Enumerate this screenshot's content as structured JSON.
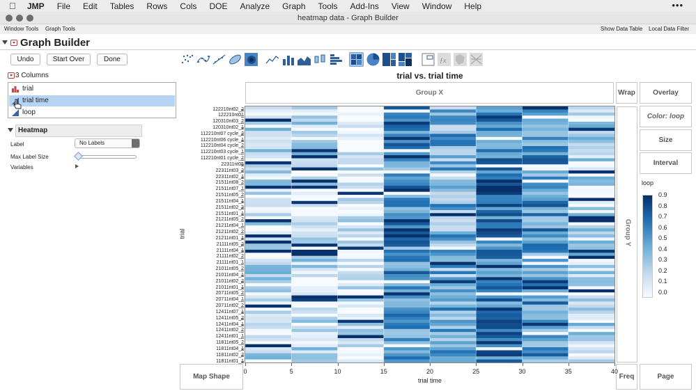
{
  "menubar": {
    "app_name": "JMP",
    "items": [
      "File",
      "Edit",
      "Tables",
      "Rows",
      "Cols",
      "DOE",
      "Analyze",
      "Graph",
      "Tools",
      "Add-Ins",
      "View",
      "Window",
      "Help"
    ],
    "more": "•••"
  },
  "window": {
    "title": "heatmap data - Graph Builder",
    "tools_left": [
      "Window Tools",
      "Graph Tools"
    ],
    "tools_right": [
      "Show Data Table",
      "Local Data Filter"
    ]
  },
  "graph_builder": {
    "title": "Graph Builder",
    "undo": "Undo",
    "start_over": "Start Over",
    "done": "Done",
    "columns_label": "3 Columns",
    "columns": [
      {
        "name": "trial",
        "icon": "nominal-icon",
        "selected": false
      },
      {
        "name": "trial time",
        "icon": "continuous-icon",
        "selected": true
      },
      {
        "name": "loop",
        "icon": "continuous-icon",
        "selected": false
      }
    ],
    "element_panel": "Heatmap",
    "label_label": "Label",
    "label_value": "No Labels",
    "max_label_size_label": "Max Label Size",
    "variables_label": "Variables",
    "graph_types": [
      "points-icon",
      "smoother-icon",
      "line-of-fit-icon",
      "ellipse-icon",
      "contour-icon",
      "line-icon",
      "bar-icon",
      "area-icon",
      "box-plot-icon",
      "histogram-icon",
      "heatmap-icon",
      "pie-icon",
      "treemap-icon",
      "mosaic-icon",
      "caption-box-icon",
      "formula-icon",
      "map-shape-icon",
      "parallel-icon"
    ]
  },
  "zones": {
    "group_x": "Group X",
    "wrap": "Wrap",
    "overlay": "Overlay",
    "color": "Color: loop",
    "size": "Size",
    "interval": "Interval",
    "group_y": "Group Y",
    "map_shape": "Map Shape",
    "freq": "Freq",
    "page": "Page"
  },
  "colors": {
    "heat_dark": "#08306b",
    "heat_mid": "#6baed6",
    "heat_light": "#f7fbff",
    "selection": "#b7d3f4",
    "graph_type_selected": "#a9c6e6"
  },
  "chart_data": {
    "type": "heatmap",
    "title": "trial vs. trial time",
    "xlabel": "trial time",
    "ylabel": "trial",
    "x_ticks": [
      0,
      5,
      10,
      15,
      20,
      25,
      30,
      35,
      40
    ],
    "xlim": [
      0,
      40
    ],
    "x_bins": [
      [
        0,
        5
      ],
      [
        5,
        10
      ],
      [
        10,
        15
      ],
      [
        15,
        20
      ],
      [
        20,
        25
      ],
      [
        25,
        30
      ],
      [
        30,
        35
      ],
      [
        35,
        40
      ]
    ],
    "y_tick_labels": [
      "122210nt02_2",
      "122210nt01",
      "120310nt03_2",
      "120310nt02_1",
      "112210nt07 cycle_2",
      "112210nt06 cycle_1",
      "112210nt04 cycle_2",
      "112210nt03 cycle_1",
      "112210nt01 cycle_2",
      "22311nt05",
      "22311nt03_2",
      "22311nt02_1",
      "21511nt08_2",
      "21511nt07_1",
      "21511nt05_2",
      "21511nt04_1",
      "21511nt02_2",
      "21511nt01_1",
      "21211nt05_2",
      "21211nt04_1",
      "21211nt02_2",
      "21211nt01_1",
      "21111nt05_2",
      "21111nt04_1",
      "21111nt02_2",
      "21111nt01_1",
      "21011nt05_2",
      "21011nt04_1",
      "21011nt02_2",
      "21011nt01_1",
      "20711nt05_2",
      "20711nt04_1",
      "20711nt02_2",
      "12411nt07_1",
      "12411nt05_2",
      "12411nt04_1",
      "12411nt02_2",
      "12411nt01_1",
      "11811nt05_2",
      "11811nt04_1",
      "11811nt02_2",
      "11811nt01_1"
    ],
    "color_variable": "loop",
    "color_scale": [
      0,
      0.1,
      0.2,
      0.3,
      0.4,
      0.5,
      0.6,
      0.7,
      0.8,
      0.9
    ],
    "bin_mean_loop": [
      0.22,
      0.2,
      0.12,
      0.55,
      0.45,
      0.62,
      0.55,
      0.22
    ],
    "legend": "right"
  }
}
